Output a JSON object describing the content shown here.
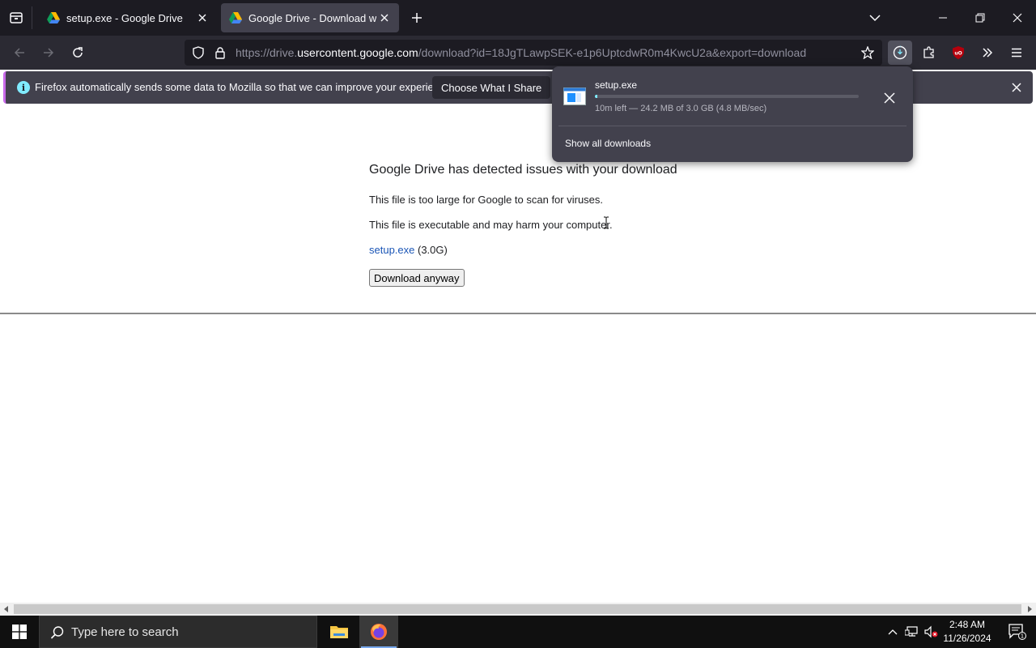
{
  "browser": {
    "tabs": [
      {
        "title": "setup.exe - Google Drive",
        "favicon": "google-drive-icon",
        "active": false
      },
      {
        "title": "Google Drive - Download warni",
        "favicon": "google-drive-icon",
        "active": true
      }
    ],
    "url": {
      "prefix": "https://drive.",
      "host": "usercontent.google.com",
      "path": "/download?id=18JgTLawpSEK-e1p6UptcdwR0m4KwcU2a&export=download"
    },
    "accent_color": "#80ebff"
  },
  "notification": {
    "text": "Firefox automatically sends some data to Mozilla so that we can improve your experience.",
    "button_label": "Choose What I Share"
  },
  "page": {
    "title": "Google Drive has detected issues with your download",
    "line1": "This file is too large for Google to scan for viruses.",
    "line2": "This file is executable and may harm your computer.",
    "file_name": "setup.exe",
    "file_size": "(3.0G)",
    "download_button": "Download anyway"
  },
  "downloads_panel": {
    "file_name": "setup.exe",
    "status": "10m left — 24.2 MB of 3.0 GB (4.8 MB/sec)",
    "progress_fraction": 0.008,
    "show_all_label": "Show all downloads"
  },
  "taskbar": {
    "search_placeholder": "Type here to search",
    "time": "2:48 AM",
    "date": "11/26/2024",
    "notification_count": "1"
  }
}
